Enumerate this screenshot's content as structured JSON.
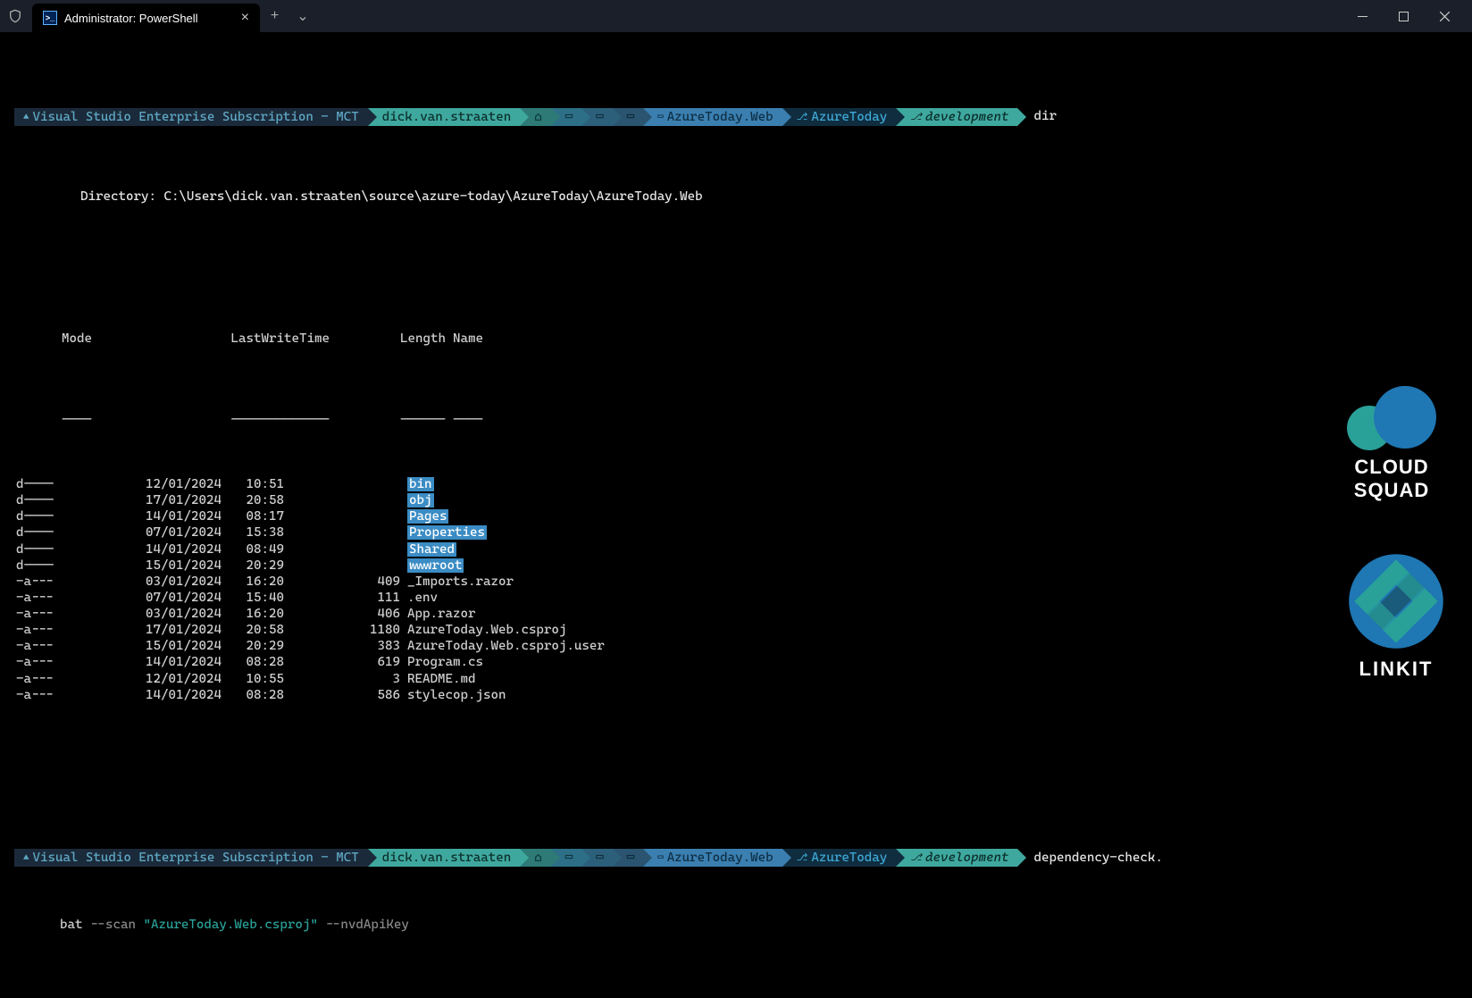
{
  "window": {
    "tab_title": "Administrator: PowerShell"
  },
  "prompt1": {
    "azure_sub": "Visual Studio Enterprise Subscription - MCT",
    "user": "dick.van.straaten",
    "project": "AzureToday.Web",
    "repo": "AzureToday",
    "branch": "development",
    "command": "dir"
  },
  "directory_line": "    Directory: C:\\Users\\dick.van.straaten\\source\\azure-today\\AzureToday\\AzureToday.Web",
  "headers": {
    "mode": "Mode",
    "lwt": "LastWriteTime",
    "len": "Length",
    "name": "Name"
  },
  "dividers": {
    "mode": "----",
    "lwt": "-------------",
    "len": "------",
    "name": "----"
  },
  "rows": [
    {
      "mode": "d----",
      "date": "12/01/2024",
      "time": "10:51",
      "len": "",
      "name": "bin",
      "dir": true
    },
    {
      "mode": "d----",
      "date": "17/01/2024",
      "time": "20:58",
      "len": "",
      "name": "obj",
      "dir": true
    },
    {
      "mode": "d----",
      "date": "14/01/2024",
      "time": "08:17",
      "len": "",
      "name": "Pages",
      "dir": true
    },
    {
      "mode": "d----",
      "date": "07/01/2024",
      "time": "15:38",
      "len": "",
      "name": "Properties",
      "dir": true
    },
    {
      "mode": "d----",
      "date": "14/01/2024",
      "time": "08:49",
      "len": "",
      "name": "Shared",
      "dir": true
    },
    {
      "mode": "d----",
      "date": "15/01/2024",
      "time": "20:29",
      "len": "",
      "name": "wwwroot",
      "dir": true
    },
    {
      "mode": "-a---",
      "date": "03/01/2024",
      "time": "16:20",
      "len": "409",
      "name": "_Imports.razor",
      "dir": false
    },
    {
      "mode": "-a---",
      "date": "07/01/2024",
      "time": "15:40",
      "len": "111",
      "name": ".env",
      "dir": false
    },
    {
      "mode": "-a---",
      "date": "03/01/2024",
      "time": "16:20",
      "len": "406",
      "name": "App.razor",
      "dir": false
    },
    {
      "mode": "-a---",
      "date": "17/01/2024",
      "time": "20:58",
      "len": "1180",
      "name": "AzureToday.Web.csproj",
      "dir": false
    },
    {
      "mode": "-a---",
      "date": "15/01/2024",
      "time": "20:29",
      "len": "383",
      "name": "AzureToday.Web.csproj.user",
      "dir": false
    },
    {
      "mode": "-a---",
      "date": "14/01/2024",
      "time": "08:28",
      "len": "619",
      "name": "Program.cs",
      "dir": false
    },
    {
      "mode": "-a---",
      "date": "12/01/2024",
      "time": "10:55",
      "len": "3",
      "name": "README.md",
      "dir": false
    },
    {
      "mode": "-a---",
      "date": "14/01/2024",
      "time": "08:28",
      "len": "586",
      "name": "stylecop.json",
      "dir": false
    }
  ],
  "prompt2": {
    "azure_sub": "Visual Studio Enterprise Subscription - MCT",
    "user": "dick.van.straaten",
    "project": "AzureToday.Web",
    "repo": "AzureToday",
    "branch": "development",
    "command_part1": "dependency-check.",
    "command_line2_a": "bat ",
    "command_line2_b": "--scan ",
    "command_line2_c": "\"AzureToday.Web.csproj\"",
    "command_line2_d": " --nvdApiKey"
  },
  "watermarks": {
    "cloud_squad_l1": "CLOUD",
    "cloud_squad_l2": "SQUAD",
    "linkit": "LINKIT"
  }
}
